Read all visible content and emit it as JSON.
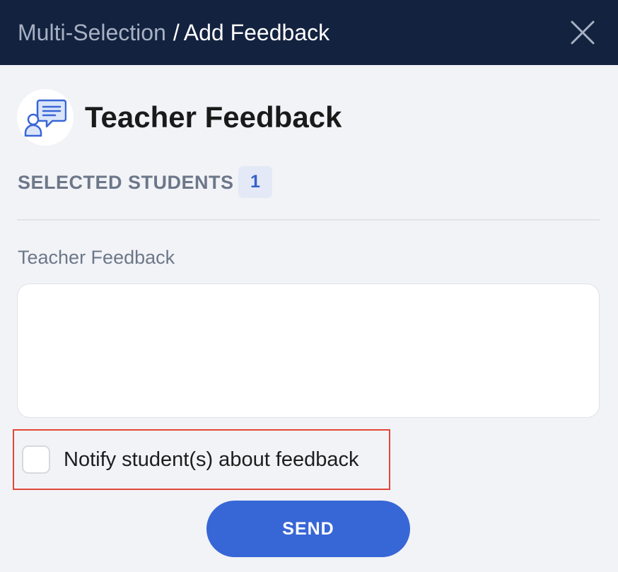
{
  "header": {
    "breadcrumb_parent": "Multi-Selection",
    "breadcrumb_separator": "/",
    "breadcrumb_current": "Add Feedback",
    "close_icon": "close-icon",
    "background_color": "#13223f"
  },
  "section": {
    "icon": "teacher-feedback-icon",
    "title": "Teacher Feedback"
  },
  "selection": {
    "label": "SELECTED STUDENTS",
    "count": "1"
  },
  "feedback_field": {
    "label": "Teacher Feedback",
    "value": "",
    "placeholder": ""
  },
  "notify": {
    "label": "Notify student(s) about feedback",
    "checked": false,
    "highlight_color": "#e2463a"
  },
  "actions": {
    "send_label": "SEND",
    "accent_color": "#3766d6"
  }
}
